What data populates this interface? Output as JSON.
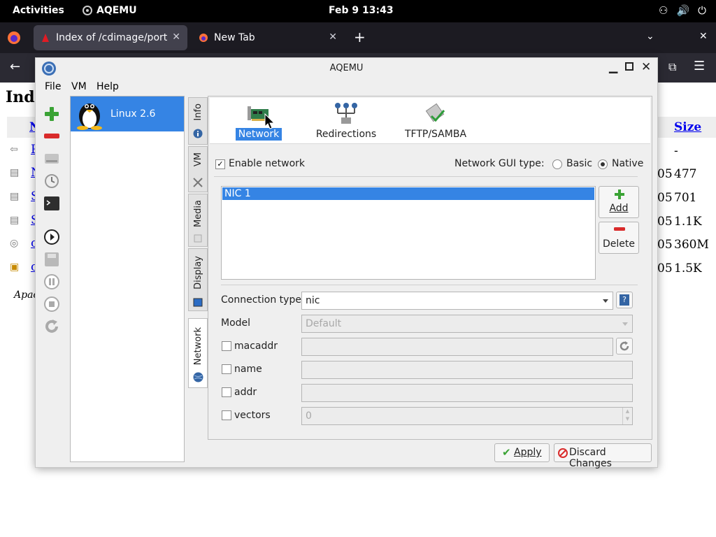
{
  "topbar": {
    "activities": "Activities",
    "app_name": "AQEMU",
    "clock": "Feb 9  13:43"
  },
  "browser": {
    "tabs": [
      {
        "label": "Index of /cdimage/ports/"
      },
      {
        "label": "New Tab"
      }
    ],
    "new_tab": "+"
  },
  "webpage": {
    "heading_partial": "Inde",
    "col_partial": "N",
    "size_header": "Size",
    "rows": [
      {
        "name": "P",
        "size_partial": "",
        "size": "-"
      },
      {
        "name": "N",
        "size_partial": "05",
        "size": "477"
      },
      {
        "name": "S",
        "size_partial": "05",
        "size": "701"
      },
      {
        "name": "S",
        "size_partial": "05",
        "size": "1.1K"
      },
      {
        "name": "c",
        "size_partial": "05",
        "size": "360M"
      },
      {
        "name": "c",
        "size_partial": "05",
        "size": "1.5K"
      }
    ],
    "footer_partial": "Apac"
  },
  "window": {
    "title": "AQEMU",
    "menu": [
      "File",
      "VM",
      "Help"
    ]
  },
  "vm_list": {
    "items": [
      {
        "name": "Linux 2.6"
      }
    ]
  },
  "side_tabs": [
    "Info",
    "VM",
    "Media",
    "Display",
    "Network"
  ],
  "top_tabs": [
    "Network",
    "Redirections",
    "TFTP/SAMBA"
  ],
  "network": {
    "enable_label": "Enable network",
    "enabled": true,
    "gui_type_label": "Network GUI type:",
    "gui_basic": "Basic",
    "gui_native": "Native",
    "nics": [
      "NIC 1"
    ],
    "add_label": "Add",
    "delete_label": "Delete",
    "connection_type_label": "Connection type",
    "connection_type_value": "nic",
    "model_label": "Model",
    "model_value": "Default",
    "macaddr_label": "macaddr",
    "name_label": "name",
    "addr_label": "addr",
    "vectors_label": "vectors",
    "vectors_value": "0"
  },
  "footer": {
    "apply": "Apply",
    "discard": "Discard Changes"
  },
  "colors": {
    "accent": "#3584e4",
    "add_green": "#3aa335",
    "delete_red": "#d92b2b"
  }
}
